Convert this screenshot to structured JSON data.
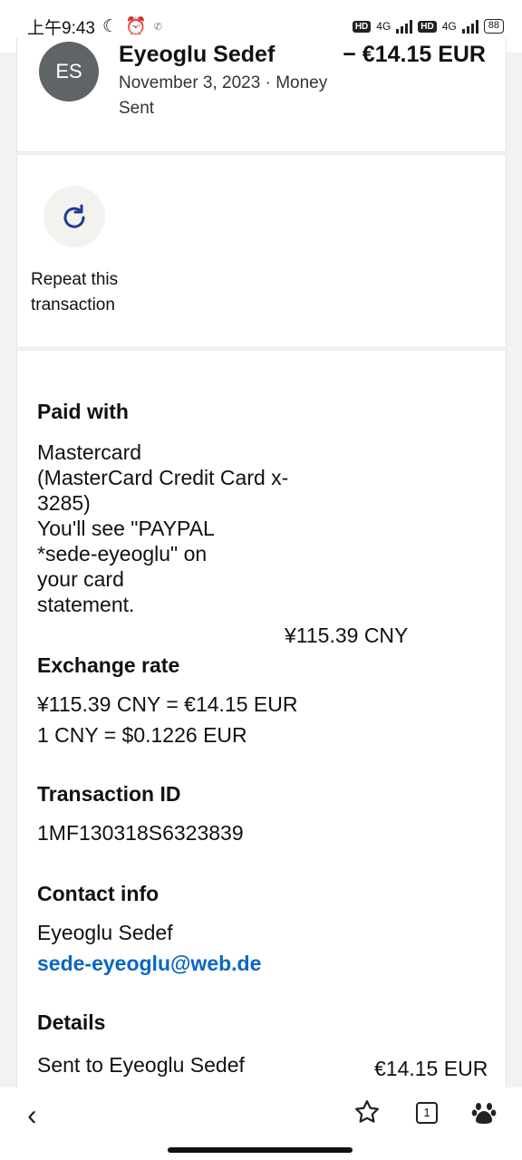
{
  "status_bar": {
    "time": "上午9:43",
    "network1": "4G",
    "network2": "4G",
    "battery": "88"
  },
  "transaction": {
    "avatar_initials": "ES",
    "payee_name": "Eyeoglu Sedef",
    "amount": "− €14.15 EUR",
    "date_line": "November 3, 2023 · Money Sent"
  },
  "repeat": {
    "label": "Repeat this transaction"
  },
  "paid_with": {
    "title": "Paid with",
    "card_line1": "Mastercard",
    "card_line2": "(MasterCard Credit Card x-",
    "card_line3": "3285)",
    "note_line1": "You'll see \"PAYPAL",
    "note_line2": "*sede-eyeoglu\" on",
    "note_line3": "your card",
    "note_line4": "statement.",
    "amount": "¥115.39 CNY"
  },
  "exchange_rate": {
    "title": "Exchange rate",
    "line1": "¥115.39 CNY = €14.15 EUR",
    "line2": "1 CNY = $0.1226 EUR"
  },
  "transaction_id": {
    "title": "Transaction ID",
    "value": "1MF130318S6323839"
  },
  "contact": {
    "title": "Contact info",
    "name": "Eyeoglu Sedef",
    "email": "sede-eyeoglu@web.de"
  },
  "details": {
    "title": "Details",
    "sent_to": "Sent to Eyeoglu Sedef",
    "amount": "€14.15 EUR"
  },
  "bottom_nav": {
    "tab_count": "1"
  }
}
